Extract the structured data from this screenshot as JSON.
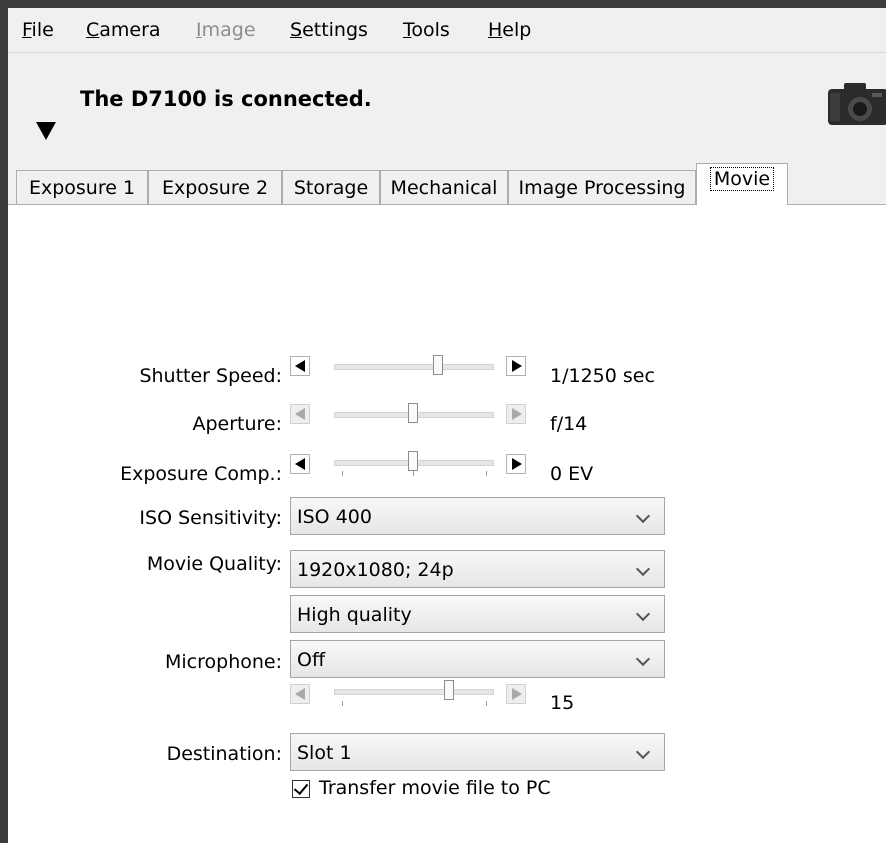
{
  "menu": [
    {
      "label": "File",
      "enabled": true
    },
    {
      "label": "Camera",
      "enabled": true
    },
    {
      "label": "Image",
      "enabled": false
    },
    {
      "label": "Settings",
      "enabled": true
    },
    {
      "label": "Tools",
      "enabled": true
    },
    {
      "label": "Help",
      "enabled": true
    }
  ],
  "status": {
    "text": "The D7100 is connected.",
    "icon": "camera-icon",
    "toggle_icon": "triangle-down-icon"
  },
  "tabs": [
    {
      "label": "Exposure 1",
      "active": false
    },
    {
      "label": "Exposure 2",
      "active": false
    },
    {
      "label": "Storage",
      "active": false
    },
    {
      "label": "Mechanical",
      "active": false
    },
    {
      "label": "Image Processing",
      "active": false
    },
    {
      "label": "Movie",
      "active": true
    }
  ],
  "settings": {
    "shutter_speed": {
      "label": "Shutter Speed:",
      "value": "1/1250 sec",
      "enabled": true,
      "slider_position": 0.66
    },
    "aperture": {
      "label": "Aperture:",
      "value": "f/14",
      "enabled": false,
      "slider_position": 0.5
    },
    "exposure_comp": {
      "label": "Exposure Comp.:",
      "value": "0 EV",
      "enabled": true,
      "slider_position": 0.5
    },
    "iso": {
      "label": "ISO Sensitivity:",
      "value": "ISO 400"
    },
    "movie_quality": {
      "label": "Movie Quality:",
      "resolution": "1920x1080; 24p",
      "quality": "High quality"
    },
    "microphone": {
      "label": "Microphone:",
      "value": "Off",
      "level": "15",
      "level_enabled": false,
      "slider_position": 0.73
    },
    "destination": {
      "label": "Destination:",
      "value": "Slot 1"
    },
    "transfer": {
      "label": "Transfer movie file to PC",
      "checked": true
    }
  }
}
